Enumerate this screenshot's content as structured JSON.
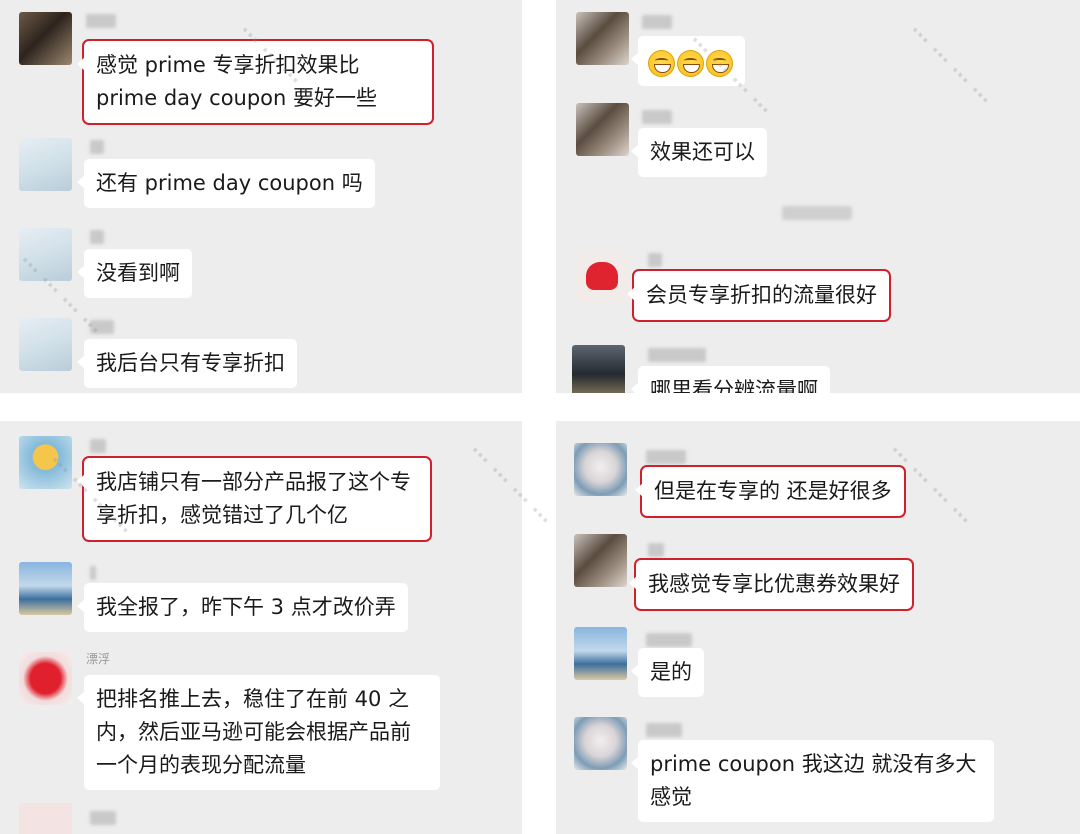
{
  "panel1": {
    "messages": [
      {
        "text": "感觉 prime 专享折扣效果比 prime day coupon 要好一些"
      },
      {
        "text": "还有 prime day coupon 吗"
      },
      {
        "text": "没看到啊"
      },
      {
        "text": "我后台只有专享折扣"
      }
    ]
  },
  "panel2": {
    "messages": [
      {
        "emoji": [
          "grinning-face-icon",
          "grinning-face-icon",
          "grinning-face-icon"
        ]
      },
      {
        "text": "效果还可以"
      },
      {
        "text": "会员专享折扣的流量很好"
      },
      {
        "text": "哪里看分辨流量啊"
      }
    ]
  },
  "panel3": {
    "messages": [
      {
        "text": "我店铺只有一部分产品报了这个专享折扣，感觉错过了几个亿"
      },
      {
        "text": "我全报了，昨下午 3 点才改价弄"
      },
      {
        "sender": "漂浮",
        "text": "把排名推上去，稳住了在前 40 之内，然后亚马逊可能会根据产品前一个月的表现分配流量"
      }
    ]
  },
  "panel4": {
    "messages": [
      {
        "text": "但是在专享的 还是好很多"
      },
      {
        "text": "我感觉专享比优惠券效果好"
      },
      {
        "text": "是的"
      },
      {
        "text": "prime coupon 我这边 就没有多大感觉"
      }
    ]
  },
  "colors": {
    "panel_bg": "#ededed",
    "bubble_bg": "#ffffff",
    "highlight": "#d0202b"
  }
}
